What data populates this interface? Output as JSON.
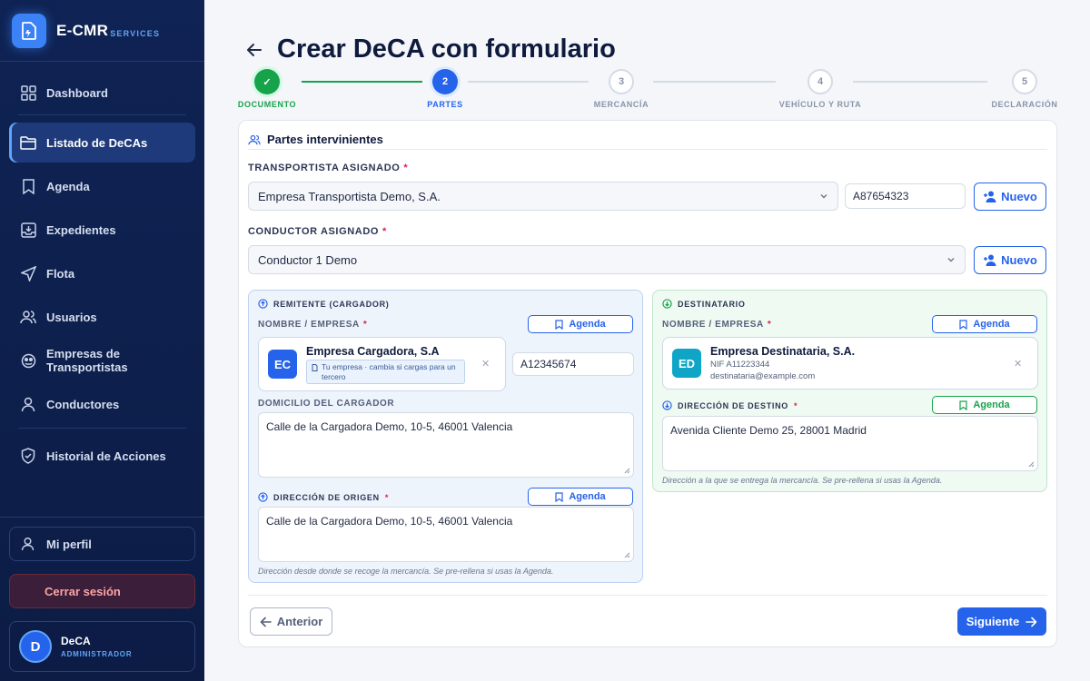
{
  "brand": {
    "name": "E-CMR",
    "sub": "SERVICES"
  },
  "nav": {
    "items": [
      {
        "label": "Dashboard",
        "icon": "dashboard-icon"
      },
      {
        "label": "Listado de DeCAs",
        "icon": "folder-icon",
        "active": true
      },
      {
        "label": "Agenda",
        "icon": "bookmark-icon"
      },
      {
        "label": "Expedientes",
        "icon": "archive-icon"
      },
      {
        "label": "Flota",
        "icon": "navigation-icon"
      },
      {
        "label": "Usuarios",
        "icon": "users-icon"
      },
      {
        "label": "Empresas de Transportistas",
        "icon": "company-icon"
      },
      {
        "label": "Conductores",
        "icon": "user-icon"
      },
      {
        "label": "Historial de Acciones",
        "icon": "shield-icon"
      }
    ]
  },
  "sidebar_bottom": {
    "profile_label": "Mi perfil",
    "logout_label": "Cerrar sesión",
    "user": {
      "initial": "D",
      "name": "DeCA",
      "role": "ADMINISTRADOR"
    }
  },
  "page": {
    "title": "Crear DeCA con formulario"
  },
  "stepper": {
    "steps": [
      {
        "num": "✓",
        "label": "DOCUMENTO",
        "state": "done"
      },
      {
        "num": "2",
        "label": "PARTES",
        "state": "active"
      },
      {
        "num": "3",
        "label": "MERCANCÍA",
        "state": "todo"
      },
      {
        "num": "4",
        "label": "VEHÍCULO Y RUTA",
        "state": "todo"
      },
      {
        "num": "5",
        "label": "DECLARACIÓN",
        "state": "todo"
      }
    ]
  },
  "section": {
    "title": "Partes intervinientes"
  },
  "transportista": {
    "label": "TRANSPORTISTA ASIGNADO",
    "value": "Empresa Transportista Demo, S.A.",
    "nif": "A87654323",
    "new_label": "Nuevo"
  },
  "conductor": {
    "label": "CONDUCTOR ASIGNADO",
    "value": "Conductor 1 Demo",
    "new_label": "Nuevo"
  },
  "remitente": {
    "title": "REMITENTE (CARGADOR)",
    "name_label": "NOMBRE / EMPRESA",
    "agenda_label": "Agenda",
    "badge": "EC",
    "company": "Empresa Cargadora, S.A",
    "tag": "Tu empresa · cambia si cargas para un tercero",
    "nif": "A12345674",
    "domicilio_label": "DOMICILIO DEL CARGADOR",
    "domicilio": "Calle de la Cargadora Demo, 10-5, 46001 Valencia",
    "origen_label": "DIRECCIÓN DE ORIGEN",
    "origen_agenda": "Agenda",
    "origen": "Calle de la Cargadora Demo, 10-5, 46001 Valencia",
    "hint": "Dirección desde donde se recoge la mercancía. Se pre-rellena si usas la Agenda."
  },
  "destinatario": {
    "title": "DESTINATARIO",
    "name_label": "NOMBRE / EMPRESA",
    "agenda_label": "Agenda",
    "badge": "ED",
    "company": "Empresa Destinataria, S.A.",
    "nif": "NIF A11223344",
    "email": "destinataria@example.com",
    "destino_label": "DIRECCIÓN DE DESTINO",
    "destino_agenda": "Agenda",
    "destino": "Avenida Cliente Demo 25, 28001 Madrid",
    "hint": "Dirección a la que se entrega la mercancía. Se pre-rellena si usas la Agenda."
  },
  "footer": {
    "prev_label": "Anterior",
    "next_label": "Siguiente"
  },
  "colors": {
    "primary": "#2563eb",
    "success": "#16a34a",
    "sidebar": "#0f2354",
    "danger": "#e11d48"
  }
}
